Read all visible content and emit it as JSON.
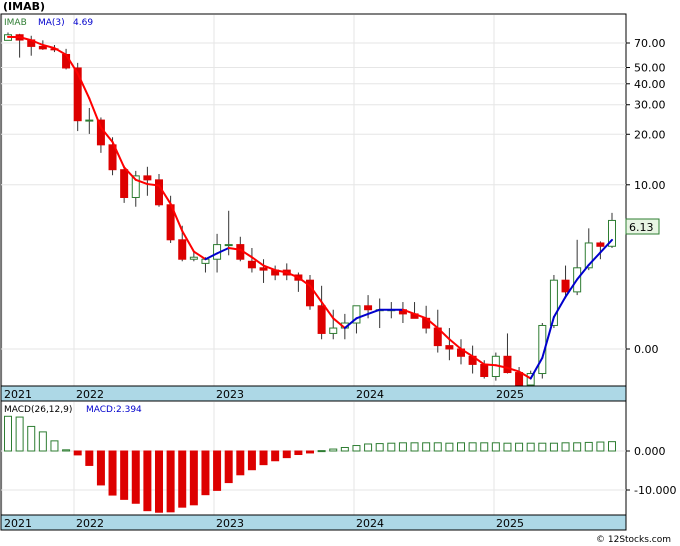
{
  "header": {
    "ticker": "(IMAB)"
  },
  "footer": {
    "credit": "© 12Stocks.com"
  },
  "colors": {
    "up": "#2e7d32",
    "down": "#dd0000",
    "ma_down": "#ff0000",
    "ma_up": "#0000cc",
    "macd_label": "#0000cc",
    "axis_band": "#add8e6"
  },
  "chart_data": [
    {
      "type": "candlestick",
      "legend": {
        "symbol": "IMAB",
        "ma_label": "MA(3)",
        "ma_value": "4.69"
      },
      "price_label": "6.13",
      "y_ticks": [
        {
          "v": 70,
          "label": "70.00"
        },
        {
          "v": 50,
          "label": "50.00"
        },
        {
          "v": 40,
          "label": "40.00"
        },
        {
          "v": 30,
          "label": "30.00"
        },
        {
          "v": 20,
          "label": "20.00"
        },
        {
          "v": 10,
          "label": "10.00"
        },
        {
          "v": 1.05,
          "label": "0.00"
        }
      ],
      "x_labels": [
        "2021",
        "2022",
        "2023",
        "2024",
        "2025"
      ],
      "ohlc": [
        [
          72.6,
          80.8,
          76.3,
          78.4
        ],
        [
          78.4,
          79.4,
          57.3,
          72.9
        ],
        [
          73.0,
          77.3,
          58.8,
          66.8
        ],
        [
          66.8,
          72.6,
          63.7,
          64.6
        ],
        [
          64.6,
          68.1,
          61.8,
          64.5
        ],
        [
          59.8,
          64.6,
          48.7,
          49.7
        ],
        [
          49.7,
          53.3,
          20.9,
          24.1
        ],
        [
          24.1,
          28.7,
          20.1,
          24.3
        ],
        [
          24.3,
          25.2,
          15.5,
          17.3
        ],
        [
          17.3,
          19.2,
          11.4,
          12.3
        ],
        [
          12.3,
          13.0,
          7.8,
          8.4
        ],
        [
          8.4,
          12.1,
          7.4,
          11.3
        ],
        [
          11.3,
          12.8,
          8.6,
          10.7
        ],
        [
          10.7,
          11.6,
          7.4,
          7.6
        ],
        [
          7.6,
          8.6,
          4.5,
          4.7
        ],
        [
          4.7,
          5.7,
          3.5,
          3.6
        ],
        [
          3.6,
          4.0,
          3.5,
          3.7
        ],
        [
          3.4,
          3.7,
          3.0,
          3.6
        ],
        [
          3.6,
          5.1,
          3.0,
          4.4
        ],
        [
          4.4,
          7.0,
          3.8,
          4.4
        ],
        [
          4.4,
          4.9,
          3.5,
          3.6
        ],
        [
          3.5,
          4.2,
          3.0,
          3.2
        ],
        [
          3.2,
          3.6,
          2.6,
          3.1
        ],
        [
          3.1,
          3.3,
          2.7,
          2.9
        ],
        [
          3.1,
          3.4,
          2.7,
          2.9
        ],
        [
          2.9,
          3.0,
          2.3,
          2.7
        ],
        [
          2.7,
          2.9,
          1.8,
          1.9
        ],
        [
          1.9,
          2.5,
          1.2,
          1.3
        ],
        [
          1.3,
          1.8,
          1.2,
          1.4
        ],
        [
          1.4,
          1.7,
          1.2,
          1.5
        ],
        [
          1.5,
          1.8,
          1.3,
          1.9
        ],
        [
          1.9,
          2.2,
          1.6,
          1.8
        ],
        [
          1.8,
          2.1,
          1.4,
          1.8
        ],
        [
          1.8,
          2.0,
          1.6,
          1.8
        ],
        [
          1.8,
          2.0,
          1.5,
          1.7
        ],
        [
          1.7,
          2.0,
          1.6,
          1.6
        ],
        [
          1.6,
          1.9,
          1.3,
          1.4
        ],
        [
          1.4,
          1.8,
          1.0,
          1.1
        ],
        [
          1.1,
          1.4,
          0.9,
          1.05
        ],
        [
          1.05,
          1.2,
          0.85,
          0.95
        ],
        [
          0.95,
          1.1,
          0.75,
          0.85
        ],
        [
          0.85,
          0.9,
          0.7,
          0.72
        ],
        [
          0.72,
          1.0,
          0.68,
          0.95
        ],
        [
          0.95,
          1.3,
          0.75,
          0.76
        ],
        [
          0.76,
          0.82,
          0.55,
          0.59
        ],
        [
          0.59,
          0.78,
          0.3,
          0.75
        ],
        [
          0.75,
          1.5,
          0.7,
          1.45
        ],
        [
          1.45,
          2.9,
          1.4,
          2.7
        ],
        [
          2.7,
          3.3,
          2.1,
          2.3
        ],
        [
          2.3,
          4.7,
          2.2,
          3.2
        ],
        [
          3.2,
          5.5,
          3.1,
          4.5
        ],
        [
          4.5,
          4.6,
          3.6,
          4.3
        ],
        [
          4.3,
          6.8,
          4.2,
          6.13
        ]
      ],
      "ma3": [
        76.1,
        75.9,
        72.7,
        68.1,
        65.3,
        59.6,
        46.1,
        32.7,
        21.9,
        18.0,
        12.7,
        10.7,
        10.1,
        9.9,
        7.7,
        5.3,
        4.0,
        3.6,
        3.9,
        4.2,
        4.1,
        3.7,
        3.3,
        3.1,
        3.0,
        2.8,
        2.5,
        2.0,
        1.6,
        1.4,
        1.6,
        1.7,
        1.8,
        1.8,
        1.8,
        1.7,
        1.6,
        1.4,
        1.2,
        1.05,
        0.95,
        0.85,
        0.84,
        0.81,
        0.77,
        0.7,
        0.93,
        1.63,
        2.15,
        2.73,
        3.33,
        3.95,
        4.69
      ],
      "macd": {
        "label": "MACD(26,12,9)",
        "value_label": "MACD:2.394",
        "y_ticks": [
          {
            "v": 0,
            "label": "0.000"
          },
          {
            "v": -10,
            "label": "-10.000"
          }
        ],
        "hist": [
          8.9,
          8.7,
          6.3,
          4.9,
          2.6,
          0.3,
          -1.0,
          -3.7,
          -8.7,
          -11.3,
          -12.4,
          -13.4,
          -15.3,
          -15.7,
          -15.6,
          -14.4,
          -13.8,
          -11.2,
          -10.1,
          -8.1,
          -6.1,
          -4.8,
          -3.5,
          -2.5,
          -1.7,
          -0.9,
          -0.5,
          0.1,
          0.5,
          0.9,
          1.4,
          1.8,
          1.9,
          2.0,
          2.1,
          2.1,
          2.1,
          2.1,
          2.0,
          2.1,
          2.1,
          2.1,
          2.1,
          2.0,
          2.0,
          2.0,
          2.0,
          2.0,
          2.1,
          2.1,
          2.2,
          2.3,
          2.394
        ]
      }
    }
  ]
}
